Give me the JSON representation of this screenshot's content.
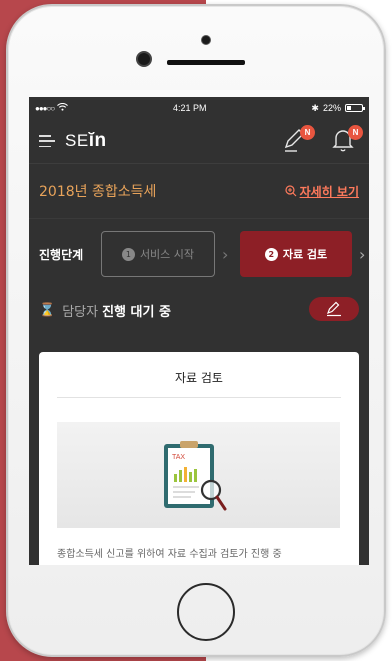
{
  "statusbar": {
    "signal": "●●●○○",
    "time": "4:21 PM",
    "battery_text": "22%",
    "battery_level": 0.22
  },
  "appbar": {
    "logo_prefix": "SE",
    "logo_suffix": "ĭn",
    "edit_badge": "N",
    "bell_badge": "N"
  },
  "header": {
    "title": "2018년 종합소득세",
    "detail_link": "자세히 보기"
  },
  "progress": {
    "label": "진행단계",
    "steps": [
      {
        "num": "1",
        "label": "서비스 시작",
        "active": false
      },
      {
        "num": "2",
        "label": "자료 검토",
        "active": true
      }
    ]
  },
  "status": {
    "owner": "담당자",
    "text": "진행 대기 중"
  },
  "card": {
    "title": "자료 검토",
    "illustration_text": "TAX",
    "description": "종합소득세 신고를 위하여 자료 수집과 검토가 진행 중"
  },
  "colors": {
    "accent": "#8d1f26",
    "badge": "#e8553f",
    "title_orange": "#e8a35a",
    "link": "#ff7a5c",
    "screen_bg": "#313131",
    "page_left": "#b7474c"
  }
}
